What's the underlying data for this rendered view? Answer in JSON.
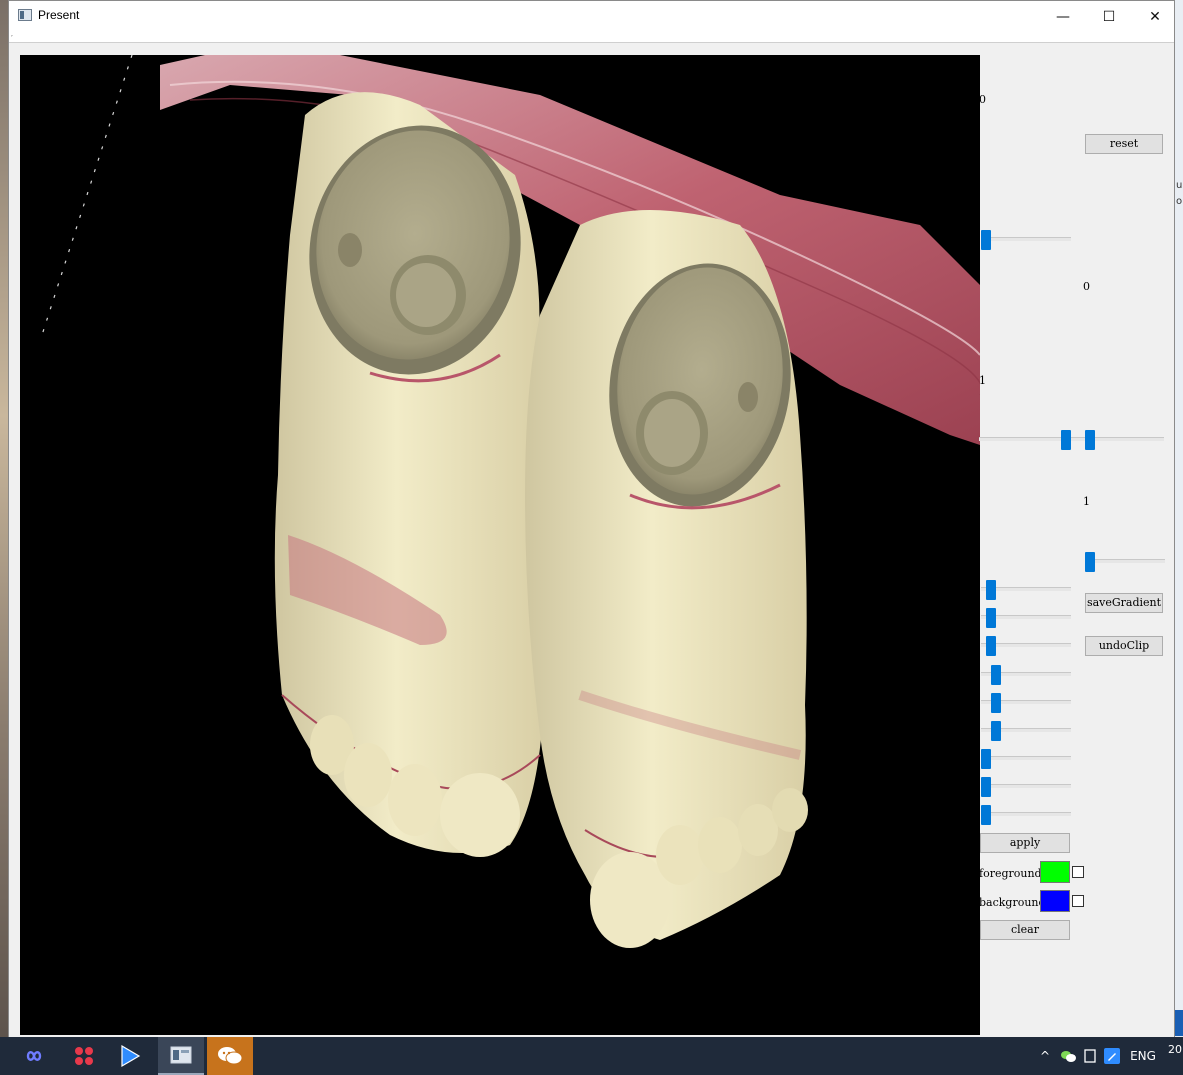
{
  "window": {
    "title": "Present"
  },
  "window_controls": {
    "minimize": "—",
    "maximize": "☐",
    "close": "✕"
  },
  "panel": {
    "top_left_value": "0",
    "top_right_value": "0",
    "mid_left_value": "1",
    "mid_right_value": "1",
    "reset_label": "reset",
    "save_gradient_label": "saveGradient",
    "undo_clip_label": "undoClip",
    "apply_label": "apply",
    "clear_label": "clear",
    "foreground_label": "foreground",
    "background_label": "background",
    "foreground_color": "#00ff00",
    "background_color": "#0000ff",
    "slider_levels": [
      0,
      0,
      0,
      0,
      0,
      0,
      0,
      0,
      0
    ]
  },
  "taskbar": {
    "apps": [
      "infinity-icon",
      "dots-icon",
      "play-icon",
      "window-app-icon",
      "wechat-icon"
    ],
    "language": "ENG",
    "clock_fragment": "20"
  }
}
